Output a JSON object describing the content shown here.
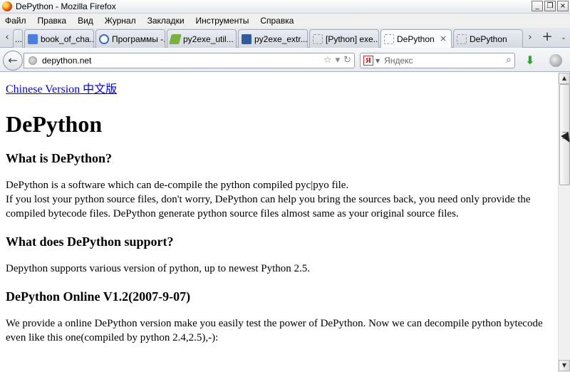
{
  "window": {
    "title": "DePython - Mozilla Firefox",
    "minimize_label": "_",
    "restore_label": "❐",
    "close_label": "×"
  },
  "menu": {
    "items": [
      "Файл",
      "Правка",
      "Вид",
      "Журнал",
      "Закладки",
      "Инструменты",
      "Справка"
    ]
  },
  "tabs": {
    "scroll_left": "‹",
    "scroll_right": "›",
    "items": [
      {
        "label": "...",
        "icon": "tab-fragment-icon",
        "color": "#8a8a8a"
      },
      {
        "label": "book_of_cha...",
        "icon": "google-icon",
        "color": "#4a7fe0"
      },
      {
        "label": "Программы -...",
        "icon": "program-icon",
        "color": "#3d6fb7"
      },
      {
        "label": "py2exe_util...",
        "icon": "leaf-icon",
        "color": "#7ab33c"
      },
      {
        "label": "py2exe_extr...",
        "icon": "python-icon",
        "color": "#2f5c9e"
      },
      {
        "label": "[Python] exe...",
        "icon": "blank-page-icon",
        "color": "#999999"
      },
      {
        "label": "DePython",
        "icon": "blank-page-icon",
        "color": "#999999",
        "active": true
      },
      {
        "label": "DePython",
        "icon": "blank-page-icon",
        "color": "#999999"
      }
    ],
    "close_label": "×",
    "new_tab_label": "+",
    "list_all_label": "⌄"
  },
  "navbar": {
    "back_label": "←",
    "url": "depython.net",
    "bookmark_star": "☆",
    "history_caret": "▾",
    "reload": "↻",
    "search_engine_logo": "Я",
    "search_placeholder": "Яндекс",
    "search_button": "⌕",
    "download_arrow": "⬇"
  },
  "page": {
    "lang_link": "Chinese Version 中文版",
    "title": "DePython",
    "sections": [
      {
        "heading": "What is DePython?",
        "paragraphs": [
          "DePython is a software which can de-compile the python compiled pyc|pyo file.",
          "If you lost your python source files, don't worry, DePython can help you bring the sources back, you need only provide the compiled bytecode files. DePython generate python source files almost same as your original source files."
        ]
      },
      {
        "heading": "What does DePython support?",
        "paragraphs": [
          "Depython supports various version of python, up to newest Python 2.5."
        ]
      },
      {
        "heading": "DePython Online V1.2(2007-9-07)",
        "paragraphs": [
          "We provide a online DePython version make you easily test the power of DePython. Now we can decompile python bytecode even like this one(compiled by python 2.4,2.5),-):"
        ]
      }
    ]
  },
  "scrollbar": {
    "up_arrow": "▲",
    "down_arrow": "▼"
  }
}
